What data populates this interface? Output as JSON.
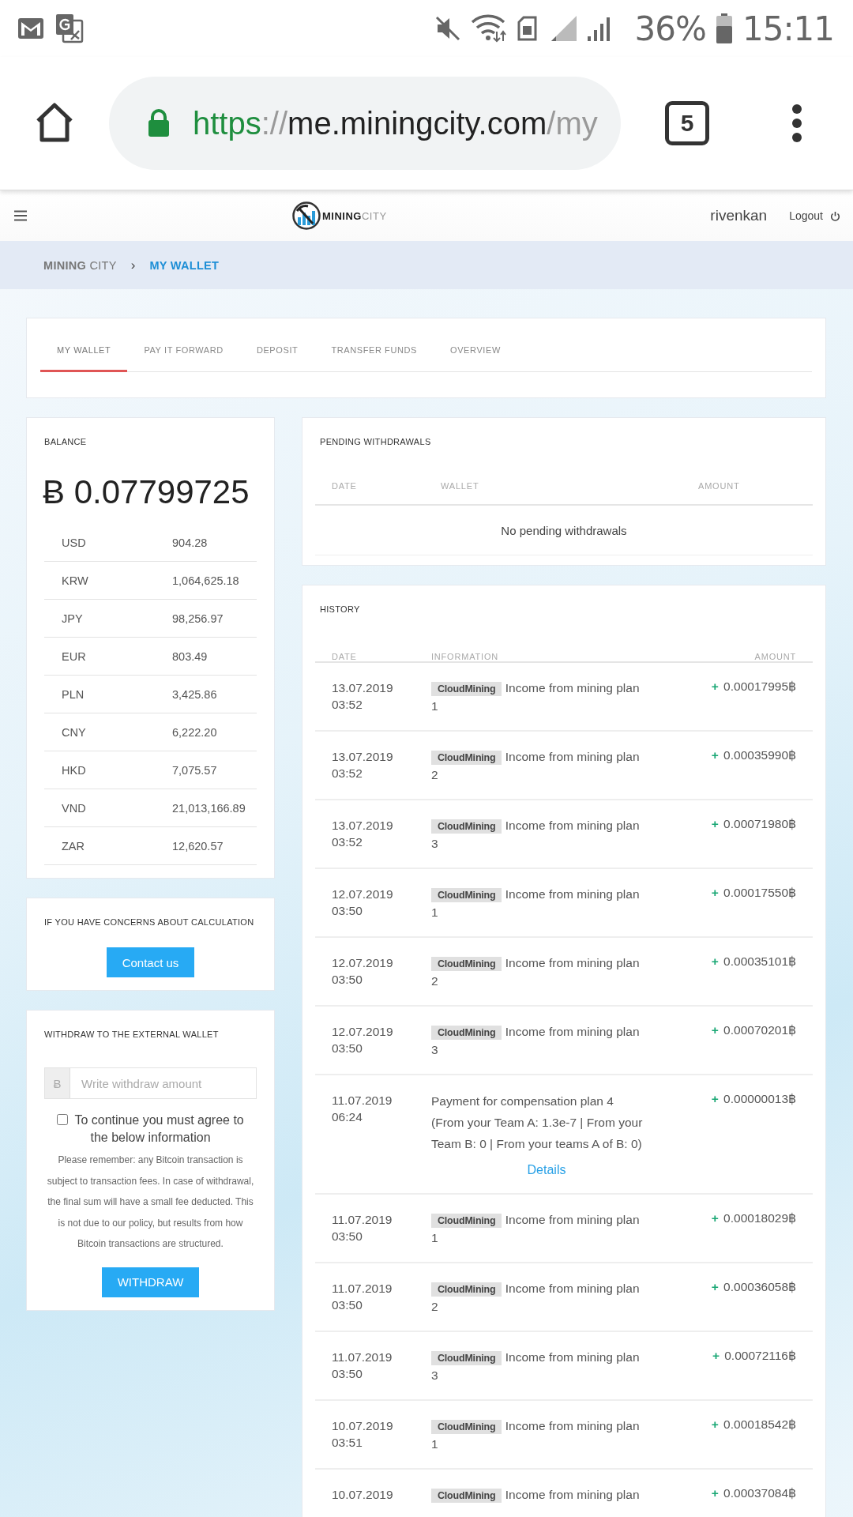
{
  "status_bar": {
    "battery": "36%",
    "time": "15:11"
  },
  "browser": {
    "url": [
      {
        "text": "https",
        "kind": "scheme"
      },
      {
        "text": "://",
        "kind": "muted"
      },
      {
        "text": "me.miningcity.com",
        "kind": "host"
      },
      {
        "text": "/my",
        "kind": "muted"
      }
    ],
    "tab_count": "5"
  },
  "header": {
    "logo": "**MINING**CITY",
    "user": "rivenkan",
    "logout": "Logout"
  },
  "breadcrumb": {
    "items": [
      {
        "label": "**MINING** CITY",
        "selected": false
      },
      {
        "label": "MY WALLET",
        "selected": true
      }
    ],
    "separator": "›"
  },
  "tabs": [
    {
      "label": "MY WALLET",
      "selected": true
    },
    {
      "label": "PAY IT FORWARD",
      "selected": false
    },
    {
      "label": "DEPOSIT",
      "selected": false
    },
    {
      "label": "TRANSFER FUNDS",
      "selected": false
    },
    {
      "label": "OVERVIEW",
      "selected": false
    }
  ],
  "balance": {
    "title": "BALANCE",
    "amount": "Ƀ 0.07799725",
    "rates": [
      {
        "currency": "USD",
        "value": "904.28"
      },
      {
        "currency": "KRW",
        "value": "1,064,625.18"
      },
      {
        "currency": "JPY",
        "value": "98,256.97"
      },
      {
        "currency": "EUR",
        "value": "803.49"
      },
      {
        "currency": "PLN",
        "value": "3,425.86"
      },
      {
        "currency": "CNY",
        "value": "6,222.20"
      },
      {
        "currency": "HKD",
        "value": "7,075.57"
      },
      {
        "currency": "VND",
        "value": "21,013,166.89"
      },
      {
        "currency": "ZAR",
        "value": "12,620.57"
      }
    ]
  },
  "concerns": {
    "title": "IF YOU HAVE CONCERNS ABOUT CALCULATION",
    "button": "Contact us"
  },
  "withdraw": {
    "title": "WITHDRAW TO THE EXTERNAL WALLET",
    "currency": "Ƀ",
    "placeholder": "Write withdraw amount",
    "agree": {
      "checked": false,
      "label": "To continue you must agree to the below information"
    },
    "notice": "Please remember: any Bitcoin transaction is subject to transaction fees. In case of withdrawal, the final sum will have a small fee deducted. This is not due to our policy, but results from how Bitcoin transactions are structured.",
    "button": "WITHDRAW"
  },
  "pending": {
    "title": "PENDING WITHDRAWALS",
    "columns": [
      "DATE",
      "WALLET",
      "AMOUNT"
    ],
    "empty": "No pending withdrawals"
  },
  "history": {
    "title": "HISTORY",
    "columns": [
      "DATE",
      "INFORMATION",
      "AMOUNT"
    ],
    "rows": [
      {
        "kind": "mining",
        "date": "13.07.2019",
        "time": "03:52",
        "tag": "CloudMining",
        "info": "Income from mining plan 1",
        "sign": "+",
        "amount": "0.00017995฿"
      },
      {
        "kind": "mining",
        "date": "13.07.2019",
        "time": "03:52",
        "tag": "CloudMining",
        "info": "Income from mining plan 2",
        "sign": "+",
        "amount": "0.00035990฿"
      },
      {
        "kind": "mining",
        "date": "13.07.2019",
        "time": "03:52",
        "tag": "CloudMining",
        "info": "Income from mining plan 3",
        "sign": "+",
        "amount": "0.00071980฿"
      },
      {
        "kind": "mining",
        "date": "12.07.2019",
        "time": "03:50",
        "tag": "CloudMining",
        "info": "Income from mining plan 1",
        "sign": "+",
        "amount": "0.00017550฿"
      },
      {
        "kind": "mining",
        "date": "12.07.2019",
        "time": "03:50",
        "tag": "CloudMining",
        "info": "Income from mining plan 2",
        "sign": "+",
        "amount": "0.00035101฿"
      },
      {
        "kind": "mining",
        "date": "12.07.2019",
        "time": "03:50",
        "tag": "CloudMining",
        "info": "Income from mining plan 3",
        "sign": "+",
        "amount": "0.00070201฿"
      },
      {
        "kind": "payment",
        "date": "11.07.2019",
        "time": "06:24",
        "info": "Payment for compensation plan 4 (From your Team A: 1.3e-7 | From your Team B: 0 | From your teams A of B: 0)",
        "link": "Details",
        "sign": "+",
        "amount": "0.00000013฿"
      },
      {
        "kind": "mining",
        "date": "11.07.2019",
        "time": "03:50",
        "tag": "CloudMining",
        "info": "Income from mining plan 1",
        "sign": "+",
        "amount": "0.00018029฿"
      },
      {
        "kind": "mining",
        "date": "11.07.2019",
        "time": "03:50",
        "tag": "CloudMining",
        "info": "Income from mining plan 2",
        "sign": "+",
        "amount": "0.00036058฿"
      },
      {
        "kind": "mining",
        "date": "11.07.2019",
        "time": "03:50",
        "tag": "CloudMining",
        "info": "Income from mining plan 3",
        "sign": "+",
        "amount": "0.00072116฿"
      },
      {
        "kind": "mining",
        "date": "10.07.2019",
        "time": "03:51",
        "tag": "CloudMining",
        "info": "Income from mining plan 1",
        "sign": "+",
        "amount": "0.00018542฿"
      },
      {
        "kind": "mining",
        "date": "10.07.2019",
        "tag": "CloudMining",
        "info": "Income from mining plan",
        "sign": "+",
        "amount": "0.00037084฿"
      }
    ]
  }
}
